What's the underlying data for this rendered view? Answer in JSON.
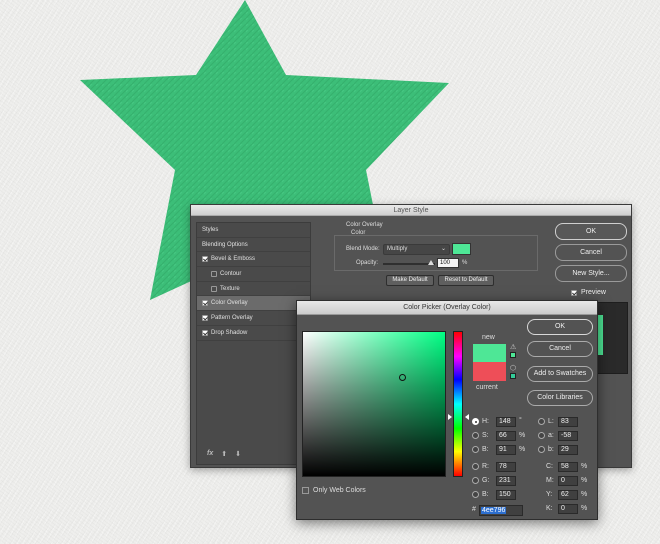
{
  "canvas": {
    "shape_color": "#3cbe78"
  },
  "layer_style": {
    "title": "Layer Style",
    "styles_list": [
      {
        "label": "Styles",
        "checkbox": "none",
        "indent": false,
        "selected": false
      },
      {
        "label": "Blending Options",
        "checkbox": "none",
        "indent": false,
        "selected": false
      },
      {
        "label": "Bevel & Emboss",
        "checkbox": "on",
        "indent": false,
        "selected": false
      },
      {
        "label": "Contour",
        "checkbox": "off",
        "indent": true,
        "selected": false
      },
      {
        "label": "Texture",
        "checkbox": "off",
        "indent": true,
        "selected": false
      },
      {
        "label": "Color Overlay",
        "checkbox": "on",
        "indent": false,
        "selected": true
      },
      {
        "label": "Pattern Overlay",
        "checkbox": "on",
        "indent": false,
        "selected": false
      },
      {
        "label": "Drop Shadow",
        "checkbox": "on",
        "indent": false,
        "selected": false
      }
    ],
    "footer": {
      "fx": "fx",
      "up": "⬆",
      "down": "⬇"
    },
    "panel": {
      "group_title": "Color Overlay",
      "subgroup_title": "Color",
      "blend_mode_label": "Blend Mode:",
      "blend_mode_value": "Multiply",
      "opacity_label": "Opacity:",
      "opacity_value": "100",
      "opacity_unit": "%",
      "overlay_color": "#4ee796",
      "make_default": "Make Default",
      "reset_default": "Reset to Default"
    },
    "buttons": {
      "ok": "OK",
      "cancel": "Cancel",
      "new_style": "New Style..."
    },
    "preview_label": "Preview"
  },
  "color_picker": {
    "title": "Color Picker (Overlay Color)",
    "new_label": "new",
    "current_label": "current",
    "new_color": "#4ee796",
    "current_color": "#ee4e58",
    "buttons": {
      "ok": "OK",
      "cancel": "Cancel",
      "add_swatches": "Add to Swatches",
      "color_libraries": "Color Libraries"
    },
    "hsb": [
      {
        "label": "H:",
        "value": "148",
        "unit": "°",
        "selected": true
      },
      {
        "label": "S:",
        "value": "66",
        "unit": "%",
        "selected": false
      },
      {
        "label": "B:",
        "value": "91",
        "unit": "%",
        "selected": false
      }
    ],
    "rgb": [
      {
        "label": "R:",
        "value": "78"
      },
      {
        "label": "G:",
        "value": "231"
      },
      {
        "label": "B:",
        "value": "150"
      }
    ],
    "lab": [
      {
        "label": "L:",
        "value": "83"
      },
      {
        "label": "a:",
        "value": "-58"
      },
      {
        "label": "b:",
        "value": "29"
      }
    ],
    "cmyk": [
      {
        "label": "C:",
        "value": "58",
        "unit": "%"
      },
      {
        "label": "M:",
        "value": "0",
        "unit": "%"
      },
      {
        "label": "Y:",
        "value": "62",
        "unit": "%"
      },
      {
        "label": "K:",
        "value": "0",
        "unit": "%"
      }
    ],
    "hex_label": "#",
    "hex_value": "4ee796",
    "only_web_colors": "Only Web Colors"
  }
}
